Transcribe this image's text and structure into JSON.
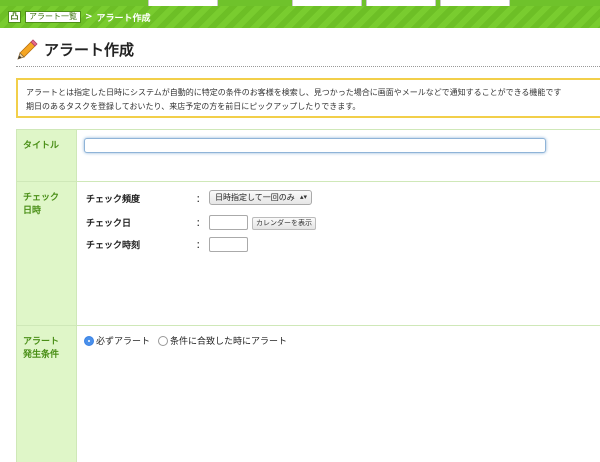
{
  "breadcrumb": {
    "home_icon": "home-icon",
    "home_glyph": "凸",
    "parent": "アラート一覧",
    "separator": ">",
    "current": "アラート作成"
  },
  "page": {
    "title": "アラート作成",
    "title_icon": "pencil-icon"
  },
  "description": {
    "line1": "アラートとは指定した日時にシステムが自動的に特定の条件のお客様を検索し、見つかった場合に画面やメールなどで通知することができる機能です",
    "line2": "期日のあるタスクを登録しておいたり、来店予定の方を前日にピックアップしたりできます。"
  },
  "form": {
    "title_row": {
      "label": "タイトル",
      "value": ""
    },
    "check_row": {
      "label_line1": "チェック",
      "label_line2": "日時",
      "frequency_label": "チェック頻度",
      "frequency_value": "日時指定して一回のみ",
      "date_label": "チェック日",
      "date_value": "",
      "calendar_button": "カレンダーを表示",
      "time_label": "チェック時刻",
      "time_value": "",
      "colon": "："
    },
    "condition_row": {
      "label_line1": "アラート",
      "label_line2": "発生条件",
      "options": [
        {
          "label": "必ずアラート",
          "checked": true
        },
        {
          "label": "条件に合致した時にアラート",
          "checked": false
        }
      ]
    }
  },
  "colors": {
    "accent_green": "#79cc2f",
    "label_bg": "#dff6c8",
    "label_text": "#4a8f17",
    "notice_border": "#f2cf4a"
  }
}
